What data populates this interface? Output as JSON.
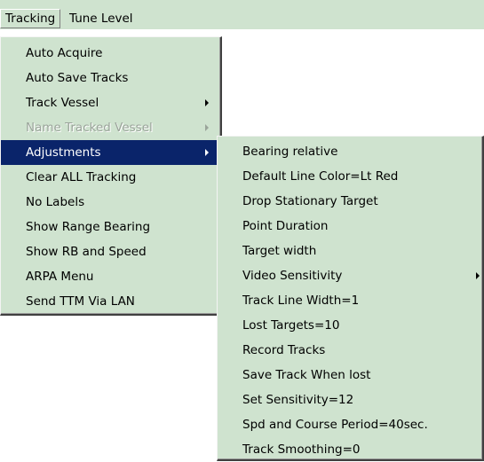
{
  "menubar": {
    "items": [
      {
        "label": "Tracking",
        "active": true
      },
      {
        "label": "Tune Level",
        "active": false
      }
    ]
  },
  "tracking_menu": {
    "items": [
      {
        "label": "Auto Acquire",
        "submenu": false,
        "disabled": false,
        "highlighted": false
      },
      {
        "label": "Auto Save Tracks",
        "submenu": false,
        "disabled": false,
        "highlighted": false
      },
      {
        "label": "Track Vessel",
        "submenu": true,
        "disabled": false,
        "highlighted": false
      },
      {
        "label": "Name Tracked Vessel",
        "submenu": true,
        "disabled": true,
        "highlighted": false
      },
      {
        "label": "Adjustments",
        "submenu": true,
        "disabled": false,
        "highlighted": true
      },
      {
        "label": "Clear ALL Tracking",
        "submenu": false,
        "disabled": false,
        "highlighted": false
      },
      {
        "label": "No Labels",
        "submenu": false,
        "disabled": false,
        "highlighted": false
      },
      {
        "label": "Show Range  Bearing",
        "submenu": false,
        "disabled": false,
        "highlighted": false
      },
      {
        "label": "Show RB and Speed",
        "submenu": false,
        "disabled": false,
        "highlighted": false
      },
      {
        "label": "ARPA Menu",
        "submenu": false,
        "disabled": false,
        "highlighted": false
      },
      {
        "label": "Send TTM Via LAN",
        "submenu": false,
        "disabled": false,
        "highlighted": false
      }
    ]
  },
  "adjustments_menu": {
    "items": [
      {
        "label": "Bearing relative",
        "submenu": false
      },
      {
        "label": "Default Line Color=Lt Red",
        "submenu": false
      },
      {
        "label": "Drop Stationary Target",
        "submenu": false
      },
      {
        "label": "Point Duration",
        "submenu": false
      },
      {
        "label": "Target width",
        "submenu": false
      },
      {
        "label": "Video Sensitivity",
        "submenu": true
      },
      {
        "label": "Track Line Width=1",
        "submenu": false
      },
      {
        "label": "Lost Targets=10",
        "submenu": false
      },
      {
        "label": "Record Tracks",
        "submenu": false
      },
      {
        "label": "Save Track When lost",
        "submenu": false
      },
      {
        "label": "Set Sensitivity=12",
        "submenu": false
      },
      {
        "label": "Spd and Course Period=40sec.",
        "submenu": false
      },
      {
        "label": "Track Smoothing=0",
        "submenu": false
      }
    ]
  }
}
